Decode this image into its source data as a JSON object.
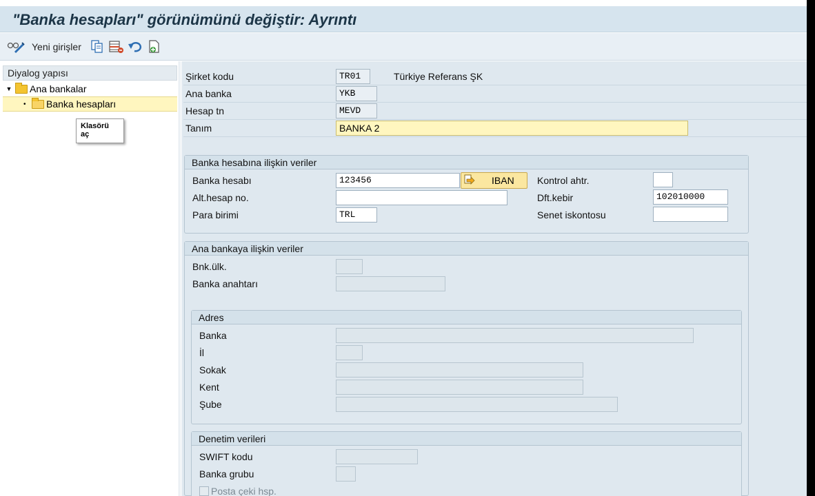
{
  "title": "\"Banka hesapları\" görünümünü değiştir: Ayrıntı",
  "toolbar": {
    "new_entries_label": "Yeni girişler",
    "icons": [
      "glasses-pencil-icon",
      "copy-icon",
      "delete-icon",
      "undo-icon",
      "transport-icon"
    ]
  },
  "left_panel": {
    "header": "Diyalog yapısı",
    "tree": [
      {
        "label": "Ana bankalar",
        "expanded": true
      },
      {
        "label": "Banka hesapları",
        "selected": true
      }
    ],
    "tooltip": "Klasörü aç"
  },
  "header_fields": {
    "company_code": {
      "label": "Şirket kodu",
      "value": "TR01",
      "desc": "Türkiye Referans ŞK"
    },
    "house_bank": {
      "label": "Ana banka",
      "value": "YKB"
    },
    "account_id": {
      "label": "Hesap tn",
      "value": "MEVD"
    },
    "description": {
      "label": "Tanım",
      "value": "BANKA 2"
    }
  },
  "bank_account_group": {
    "title": "Banka hesabına ilişkin veriler",
    "bank_account": {
      "label": "Banka hesabı",
      "value": "123456"
    },
    "iban_button": "IBAN",
    "alt_account": {
      "label": "Alt.hesap no.",
      "value": ""
    },
    "currency": {
      "label": "Para birimi",
      "value": "TRL"
    },
    "control_key": {
      "label": "Kontrol ahtr.",
      "value": ""
    },
    "gl_account": {
      "label": "Dft.kebir",
      "value": "102010000"
    },
    "discount": {
      "label": "Senet iskontosu",
      "value": ""
    }
  },
  "house_bank_group": {
    "title": "Ana bankaya ilişkin veriler",
    "bank_country": {
      "label": "Bnk.ülk.",
      "value": ""
    },
    "bank_key": {
      "label": "Banka anahtarı",
      "value": ""
    }
  },
  "address_group": {
    "title": "Adres",
    "bank": {
      "label": "Banka",
      "value": ""
    },
    "region": {
      "label": "İl",
      "value": ""
    },
    "street": {
      "label": "Sokak",
      "value": ""
    },
    "city": {
      "label": "Kent",
      "value": ""
    },
    "branch": {
      "label": "Şube",
      "value": ""
    }
  },
  "control_group": {
    "title": "Denetim verileri",
    "swift": {
      "label": "SWIFT kodu",
      "value": ""
    },
    "bank_group": {
      "label": "Banka grubu",
      "value": ""
    },
    "postal_check": {
      "label": "Posta çeki hsp.",
      "checked": false
    }
  }
}
